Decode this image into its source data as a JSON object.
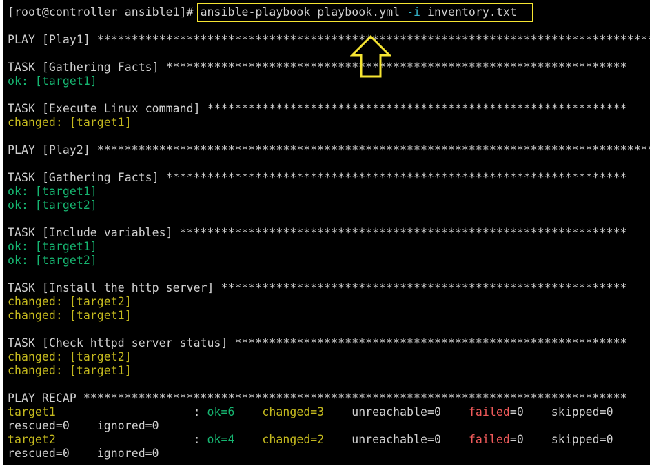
{
  "terminal": {
    "colors": {
      "default": "#d0d0d0",
      "ok": "#16b671",
      "changed": "#c4b91e",
      "failed": "#ef5a5a",
      "flag": "#34b1c6",
      "highlight": "#f6e532"
    },
    "lines": [
      [
        {
          "t": "[root@controller ansible1]# ",
          "c": "default"
        },
        {
          "t": "ansible-playbook playbook.yml ",
          "c": "default"
        },
        {
          "t": "-i",
          "c": "cyan"
        },
        {
          "t": " inventory.txt",
          "c": "default"
        }
      ],
      [
        {
          "t": "",
          "c": "default"
        }
      ],
      [
        {
          "t": "PLAY [Play1] *********************************************************************************",
          "c": "default"
        }
      ],
      [
        {
          "t": "",
          "c": "default"
        }
      ],
      [
        {
          "t": "TASK [Gathering Facts] *******************************************************************",
          "c": "default"
        }
      ],
      [
        {
          "t": "ok: [target1]",
          "c": "green"
        }
      ],
      [
        {
          "t": "",
          "c": "default"
        }
      ],
      [
        {
          "t": "TASK [Execute Linux command] *************************************************************",
          "c": "default"
        }
      ],
      [
        {
          "t": "changed: [target1]",
          "c": "yellow"
        }
      ],
      [
        {
          "t": "",
          "c": "default"
        }
      ],
      [
        {
          "t": "PLAY [Play2] *********************************************************************************",
          "c": "default"
        }
      ],
      [
        {
          "t": "",
          "c": "default"
        }
      ],
      [
        {
          "t": "TASK [Gathering Facts] *******************************************************************",
          "c": "default"
        }
      ],
      [
        {
          "t": "ok: [target1]",
          "c": "green"
        }
      ],
      [
        {
          "t": "ok: [target2]",
          "c": "green"
        }
      ],
      [
        {
          "t": "",
          "c": "default"
        }
      ],
      [
        {
          "t": "TASK [Include variables] *****************************************************************",
          "c": "default"
        }
      ],
      [
        {
          "t": "ok: [target1]",
          "c": "green"
        }
      ],
      [
        {
          "t": "ok: [target2]",
          "c": "green"
        }
      ],
      [
        {
          "t": "",
          "c": "default"
        }
      ],
      [
        {
          "t": "TASK [Install the http server] ***********************************************************",
          "c": "default"
        }
      ],
      [
        {
          "t": "changed: [target2]",
          "c": "yellow"
        }
      ],
      [
        {
          "t": "changed: [target1]",
          "c": "yellow"
        }
      ],
      [
        {
          "t": "",
          "c": "default"
        }
      ],
      [
        {
          "t": "TASK [Check httpd server status] *********************************************************",
          "c": "default"
        }
      ],
      [
        {
          "t": "changed: [target2]",
          "c": "yellow"
        }
      ],
      [
        {
          "t": "changed: [target1]",
          "c": "yellow"
        }
      ],
      [
        {
          "t": "",
          "c": "default"
        }
      ],
      [
        {
          "t": "PLAY RECAP *******************************************************************************",
          "c": "default"
        }
      ],
      [
        {
          "t": "target1",
          "c": "yellow"
        },
        {
          "t": "                    : ",
          "c": "default"
        },
        {
          "t": "ok=6",
          "c": "green"
        },
        {
          "t": "    ",
          "c": "default"
        },
        {
          "t": "changed=3",
          "c": "yellow"
        },
        {
          "t": "    unreachable=0    ",
          "c": "default"
        },
        {
          "t": "failed",
          "c": "red"
        },
        {
          "t": "=0    skipped=0",
          "c": "default"
        }
      ],
      [
        {
          "t": "rescued=0    ignored=0",
          "c": "default"
        }
      ],
      [
        {
          "t": "target2",
          "c": "yellow"
        },
        {
          "t": "                    : ",
          "c": "default"
        },
        {
          "t": "ok=4",
          "c": "green"
        },
        {
          "t": "    ",
          "c": "default"
        },
        {
          "t": "changed=2",
          "c": "yellow"
        },
        {
          "t": "    unreachable=0    ",
          "c": "default"
        },
        {
          "t": "failed",
          "c": "red"
        },
        {
          "t": "=0    skipped=0",
          "c": "default"
        }
      ],
      [
        {
          "t": "rescued=0    ignored=0",
          "c": "default"
        }
      ]
    ]
  }
}
